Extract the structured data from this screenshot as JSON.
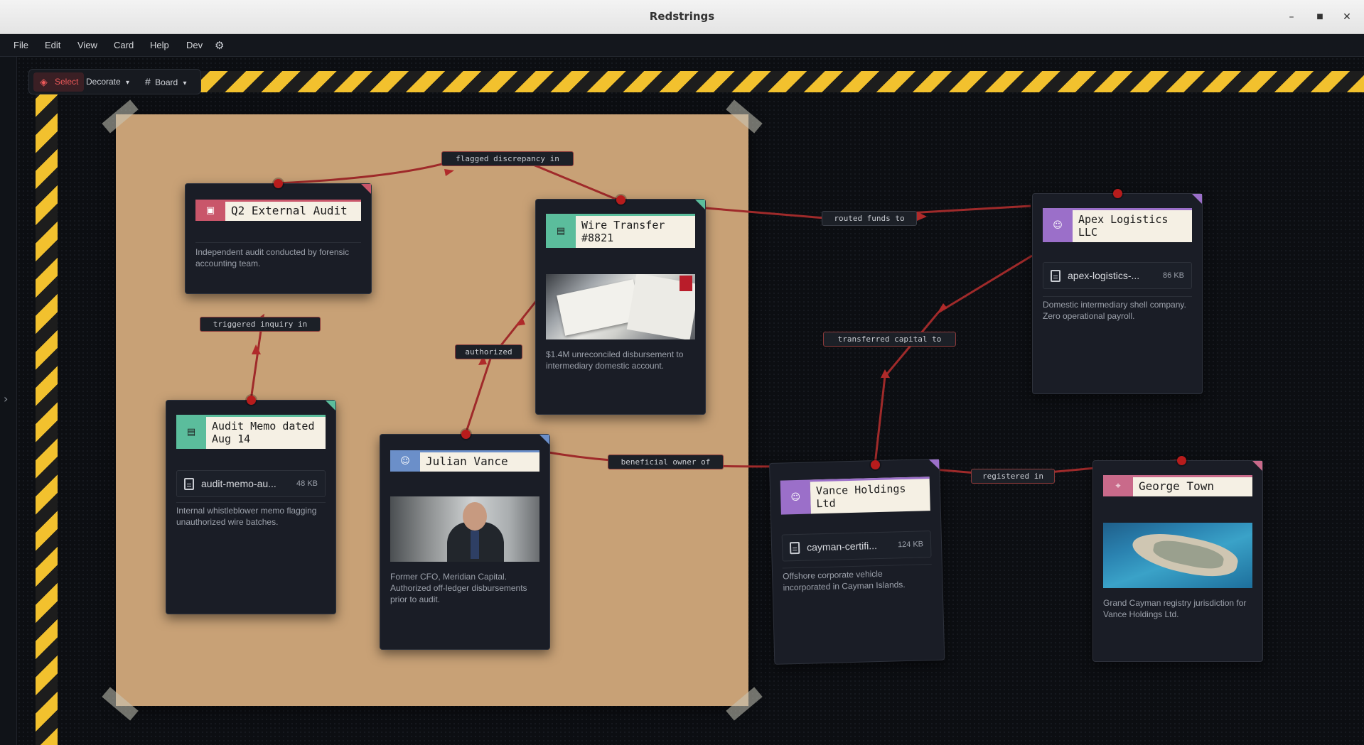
{
  "window": {
    "title": "Redstrings"
  },
  "menu": {
    "items": [
      "File",
      "Edit",
      "View",
      "Card",
      "Help",
      "Dev"
    ]
  },
  "toolbar": {
    "select_label": "Select",
    "decorate_label": "Decorate",
    "board_label": "Board"
  },
  "edges": {
    "flagged": "flagged discrepancy in",
    "routed": "routed funds to",
    "triggered": "triggered inquiry in",
    "authorized": "authorized",
    "transferred": "transferred capital to",
    "beneficial": "beneficial owner of",
    "registered": "registered in"
  },
  "cards": {
    "audit": {
      "title": "Q2 External Audit",
      "desc": "Independent audit conducted by forensic accounting team.",
      "color": "#c9566a"
    },
    "wire": {
      "title": "Wire Transfer #8821",
      "desc": "$1.4M unreconciled disbursement to intermediary domestic account.",
      "color": "#5bbd9c"
    },
    "apex": {
      "title": "Apex Logistics LLC",
      "file": "apex-logistics-...",
      "size": "86 KB",
      "desc": "Domestic intermediary shell company. Zero operational payroll.",
      "color": "#9b6fc9"
    },
    "memo": {
      "title": "Audit Memo dated Aug 14",
      "file": "audit-memo-au...",
      "size": "48 KB",
      "desc": "Internal whistleblower memo flagging unauthorized wire batches.",
      "color": "#5bbd9c"
    },
    "julian": {
      "title": "Julian Vance",
      "desc": "Former CFO, Meridian Capital. Authorized off-ledger disbursements prior to audit.",
      "color": "#6b8fc9"
    },
    "vance": {
      "title": "Vance Holdings Ltd",
      "file": "cayman-certifi...",
      "size": "124 KB",
      "desc": "Offshore corporate vehicle incorporated in Cayman Islands.",
      "color": "#9b6fc9"
    },
    "george": {
      "title": "George Town",
      "desc": "Grand Cayman registry jurisdiction for Vance Holdings Ltd.",
      "color": "#c96a8a"
    }
  }
}
